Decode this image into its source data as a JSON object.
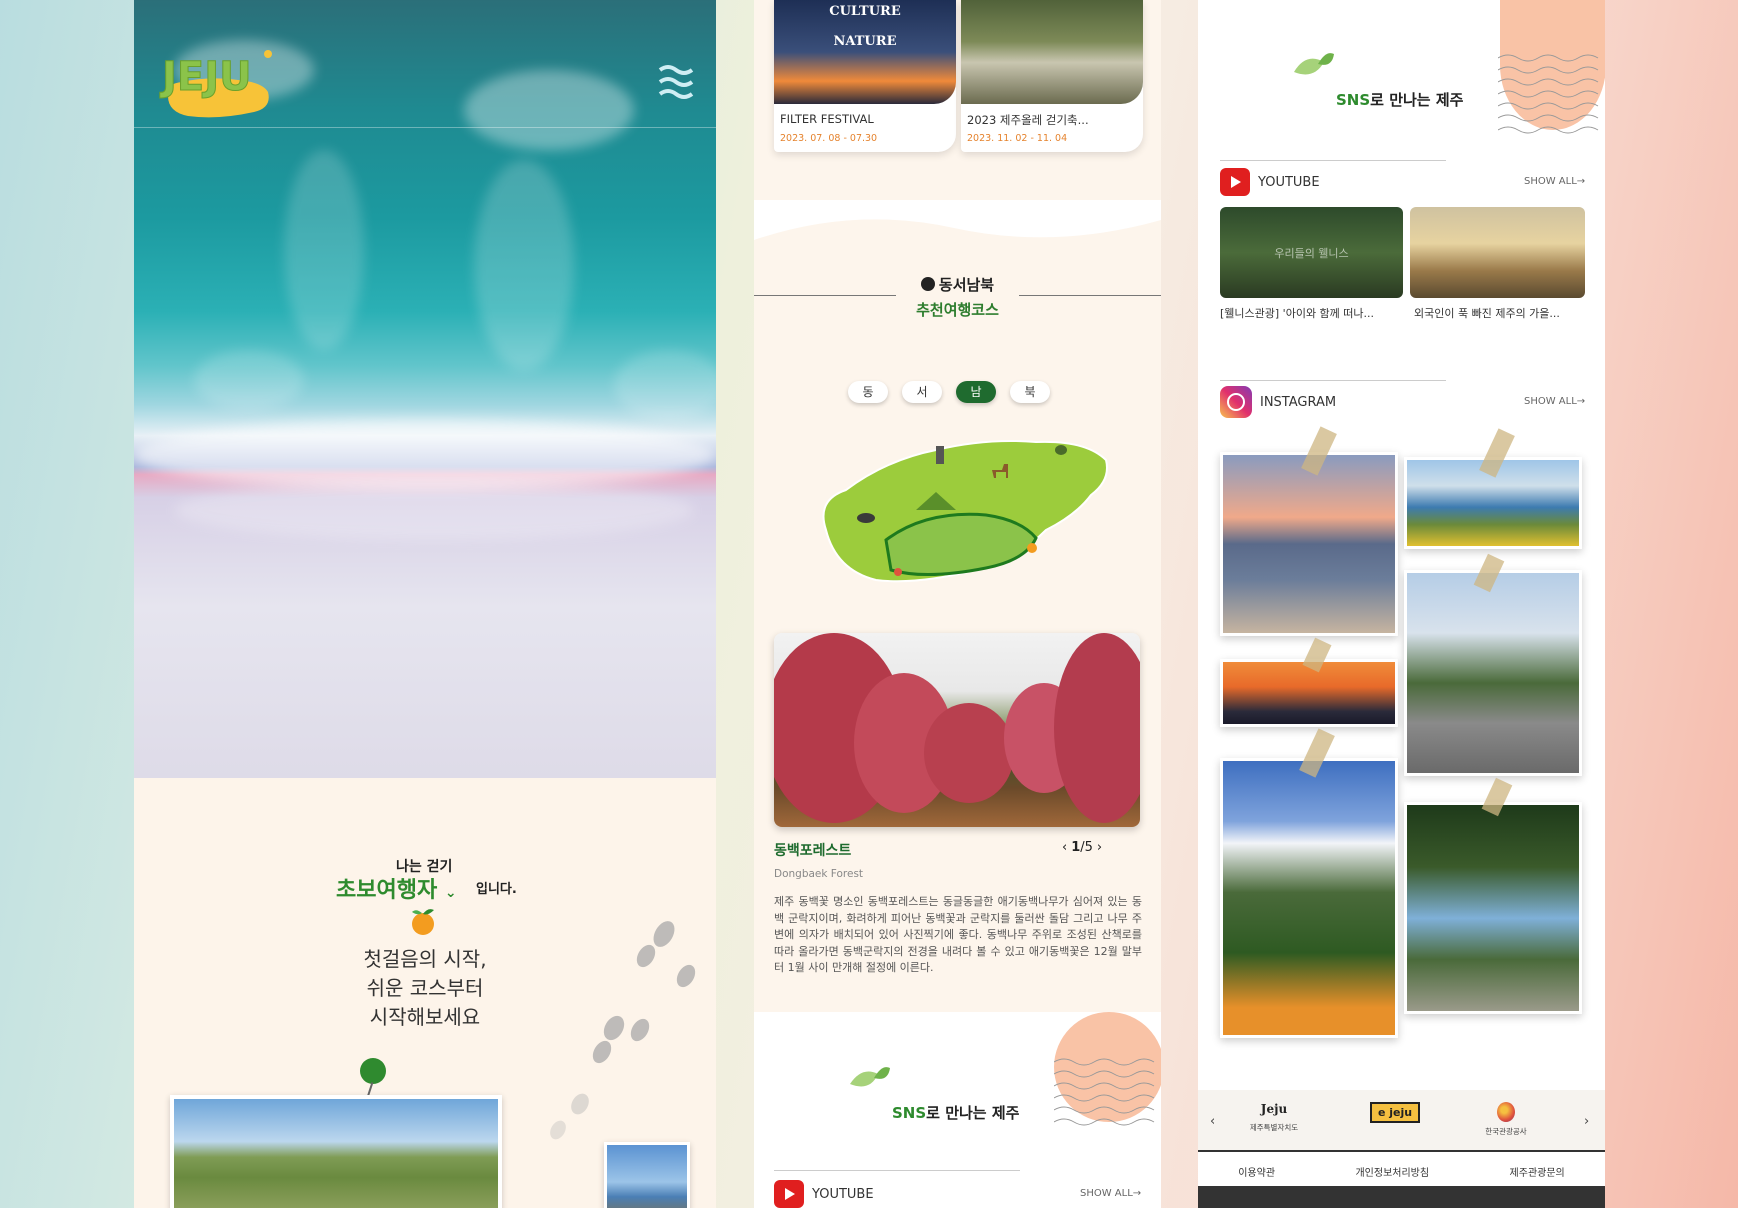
{
  "panel1": {
    "logo_text": "JEJU",
    "intro": {
      "small": "나는 걷기",
      "level": "초보여행자",
      "suffix": "입니다."
    },
    "tagline": [
      "첫걸음의 시작,",
      "쉬운 코스부터",
      "시작해보세요"
    ]
  },
  "panel2": {
    "festivals": [
      {
        "title": "FILTER FESTIVAL",
        "date": "2023. 07. 08 - 07.30",
        "poster_top": "CULTURE",
        "poster_bottom": "NATURE"
      },
      {
        "title": "2023 제주올레 걷기축...",
        "date": "2023. 11. 02 - 11. 04"
      }
    ],
    "course": {
      "heading": "동서남북",
      "subheading": "추천여행코스",
      "directions": [
        "동",
        "서",
        "남",
        "북"
      ],
      "active_direction": "남"
    },
    "place": {
      "name": "동백포레스트",
      "name_en": "Dongbaek Forest",
      "page_current": "1",
      "page_total": "/5",
      "description": "제주 동백꽃 명소인 동백포레스트는 동글동글한 애기동백나무가 심어져 있는 동백 군락지이며, 화려하게 피어난 동백꽃과 군락지를 둘러싼 돌담 그리고 나무 주변에 의자가 배치되어 있어 사진찍기에 좋다. 동백나무 주위로 조성된 산책로를 따라 올라가면 동백군락지의 전경을 내려다 볼 수 있고 애기동백꽃은 12월 말부터 1월 사이 만개해 절정에 이른다."
    },
    "sns": {
      "title_highlight": "SNS",
      "title_rest": "로 만나는 제주",
      "youtube_label": "YOUTUBE",
      "show_all": "SHOW ALL→"
    }
  },
  "panel3": {
    "sns": {
      "title_highlight": "SNS",
      "title_rest": "로 만나는 제주"
    },
    "youtube": {
      "label": "YOUTUBE",
      "show_all": "SHOW ALL→",
      "videos": [
        {
          "caption": "[웰니스관광] '아이와 함께 떠나...",
          "overlay": "우리들의 웰니스"
        },
        {
          "caption": "외국인이 푹 빠진 제주의 가을..."
        }
      ]
    },
    "instagram": {
      "label": "INSTAGRAM",
      "show_all": "SHOW ALL→"
    },
    "partners": [
      {
        "logo": "Jeju",
        "name": "제주특별자치도"
      },
      {
        "logo": "e jeju",
        "name": ""
      },
      {
        "logo": "",
        "name": "한국관광공사"
      }
    ],
    "footer_links": [
      "이용약관",
      "개인정보처리방침",
      "제주관광문의"
    ]
  },
  "colors": {
    "accent_green": "#2e8b2e",
    "dark_green": "#1f6b2f",
    "date_orange": "#e5832e",
    "youtube_red": "#e01f1f"
  }
}
